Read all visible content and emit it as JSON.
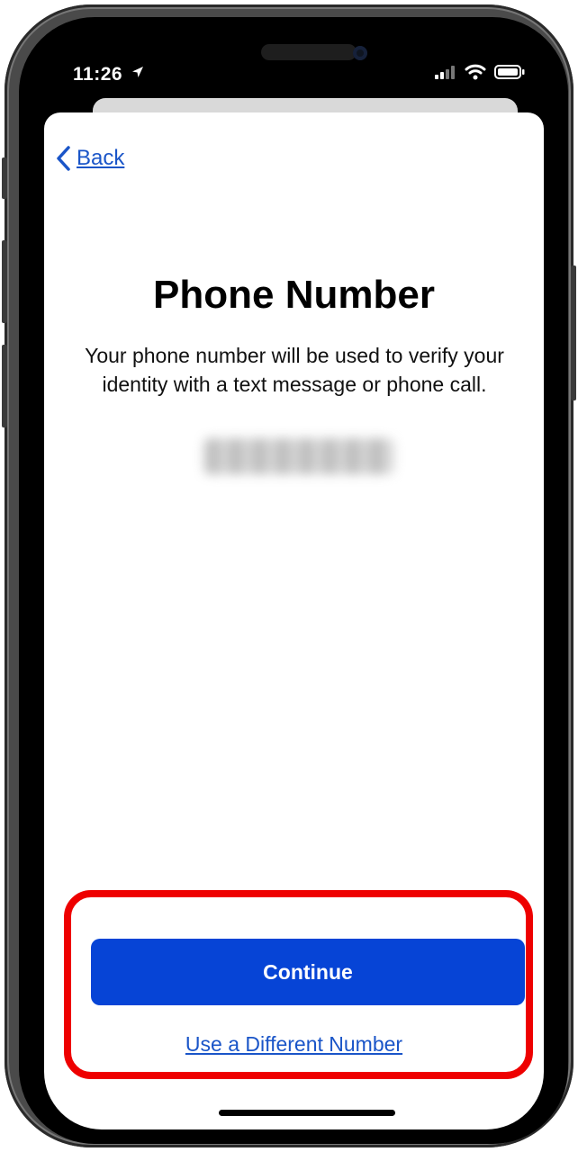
{
  "status_bar": {
    "time": "11:26",
    "location_icon": "location-arrow-icon",
    "signal_icon": "cellular-signal-icon",
    "wifi_icon": "wifi-icon",
    "battery_icon": "battery-icon"
  },
  "nav": {
    "back_label": "Back",
    "back_icon": "chevron-left-icon"
  },
  "content": {
    "title": "Phone Number",
    "description": "Your phone number will be used to verify your identity with a text message or phone call."
  },
  "actions": {
    "continue_label": "Continue",
    "different_number_label": "Use a Different Number"
  },
  "colors": {
    "accent": "#0644d6",
    "link": "#1a55c8",
    "highlight": "#ee0000"
  }
}
